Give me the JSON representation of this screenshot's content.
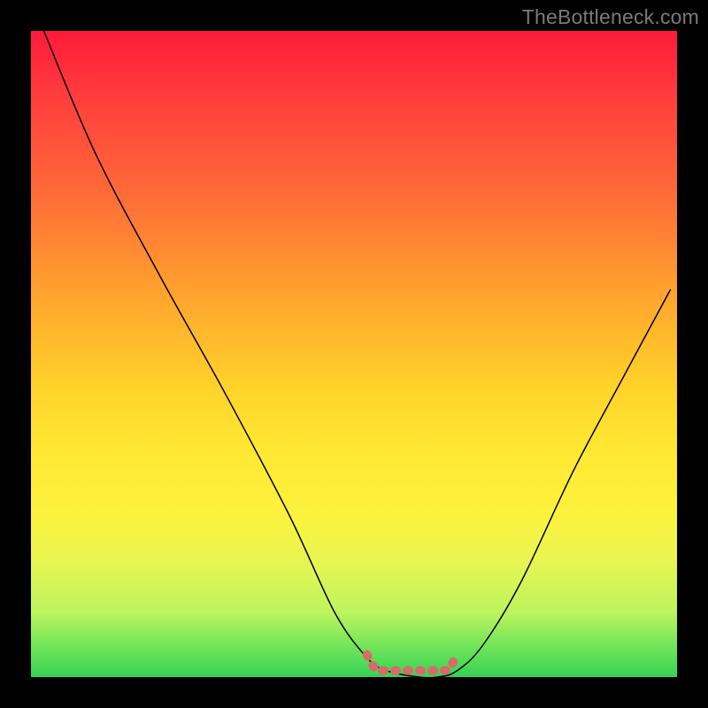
{
  "watermark": "TheBottleneck.com",
  "colors": {
    "background": "#000000",
    "curve": "#000000",
    "marker": "#d86a6a",
    "gradient_top": "#ff1a3a",
    "gradient_bottom": "#35d255"
  },
  "chart_data": {
    "type": "line",
    "title": "",
    "xlabel": "",
    "ylabel": "",
    "xlim": [
      0,
      100
    ],
    "ylim": [
      0,
      100
    ],
    "grid": false,
    "legend_position": "none",
    "series": [
      {
        "name": "bottleneck-curve",
        "x": [
          2,
          10,
          20,
          30,
          40,
          47,
          52,
          55,
          60,
          63,
          66,
          70,
          76,
          84,
          92,
          99
        ],
        "values": [
          100,
          81,
          62,
          44,
          25,
          10,
          3,
          1,
          0,
          0,
          1,
          5,
          15,
          32,
          47,
          60
        ]
      }
    ],
    "annotations": [
      {
        "name": "optimal-range-marker",
        "x_start": 52,
        "x_end": 66,
        "y": 1
      }
    ]
  }
}
